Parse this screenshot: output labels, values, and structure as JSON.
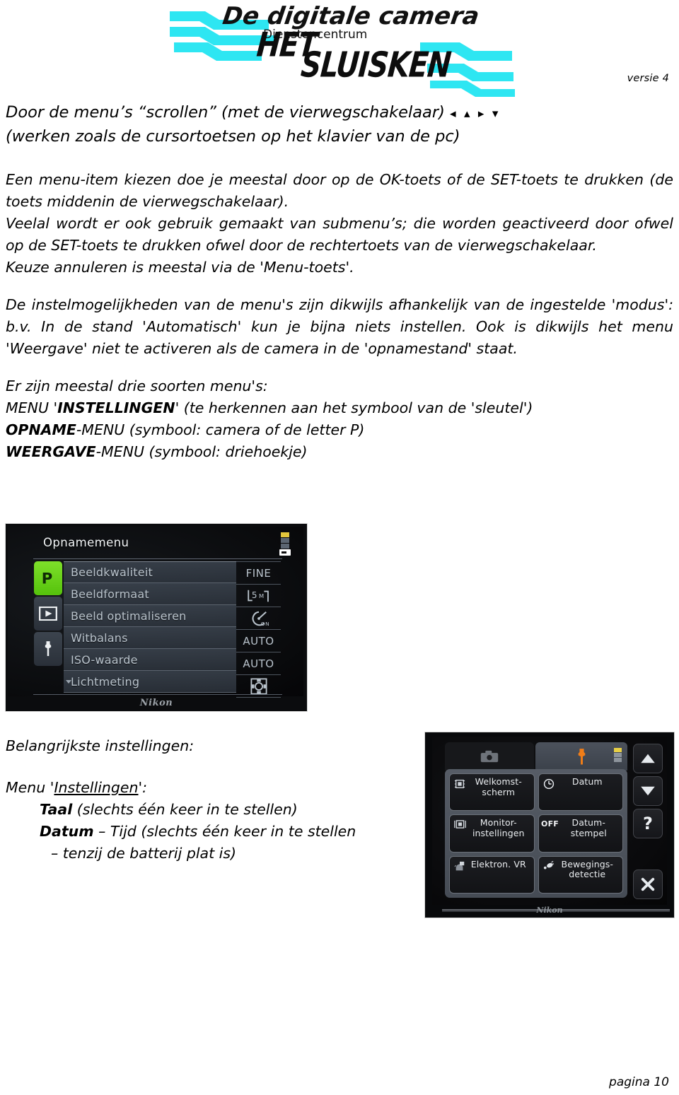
{
  "header": {
    "logo_title": "De digitale camera",
    "logo_sub": "Dienstencentrum",
    "logo_word1": "HET",
    "logo_word2": "SLUISKEN",
    "version_label": "versie 4",
    "logo_stripe_color": "#2ee6f2"
  },
  "body": {
    "line1": "Door de menu’s “scrollen” (met de vierwegschakelaar)",
    "arrows": "◂ ▴ ▸ ▾",
    "line2": "(werken zoals de cursortoetsen op het klavier van de pc)",
    "para1": "Een menu-item kiezen doe je meestal door op de OK-toets of de SET-toets te drukken (de toets middenin de vierwegschakelaar).",
    "para2": "Veelal wordt er ook gebruik gemaakt van submenu’s; die worden geactiveerd door ofwel op de SET-toets te drukken ofwel door de rechtertoets van de vierwegschakelaar.",
    "para3": "Keuze annuleren is meestal via de 'Menu-toets'.",
    "para4": "De instelmogelijkheden van de menu's zijn dikwijls afhankelijk van de ingestelde 'modus': b.v. In de stand 'Automatisch' kun je bijna niets instellen. Ook is dikwijls het menu 'Weergave' niet te activeren als de camera in de 'opnamestand' staat.",
    "para5": "Er zijn meestal drie soorten menu's:",
    "menu_kinds": [
      {
        "prefix": "MENU '",
        "bold": "INSTELLINGEN",
        "suffix": "' (te herkennen aan het symbool van de 'sleutel')"
      },
      {
        "prefix": "",
        "bold": "OPNAME",
        "suffix": "-MENU (symbool: camera of de letter P)"
      },
      {
        "prefix": "",
        "bold": "WEERGAVE",
        "suffix": "-MENU (symbool: driehoekje)"
      }
    ]
  },
  "shot1": {
    "title": "Opnamemenu",
    "brand": "Nikon",
    "tabs": [
      {
        "name": "opname-tab",
        "glyph": "P",
        "active": true
      },
      {
        "name": "weergave-tab",
        "glyph": "play",
        "active": false
      },
      {
        "name": "instellingen-tab",
        "glyph": "wrench",
        "active": false
      }
    ],
    "rows": [
      {
        "label": "Beeldkwaliteit",
        "value": "FINE",
        "value_type": "text"
      },
      {
        "label": "Beeldformaat",
        "value": "5M",
        "value_type": "size-icon"
      },
      {
        "label": "Beeld optimaliseren",
        "value": "ON",
        "value_type": "optimise-icon"
      },
      {
        "label": "Witbalans",
        "value": "AUTO",
        "value_type": "text"
      },
      {
        "label": "ISO-waarde",
        "value": "AUTO",
        "value_type": "text"
      },
      {
        "label": "Lichtmeting",
        "value": "matrix",
        "value_type": "meter-icon"
      }
    ],
    "active_tab_color": "#6fd820"
  },
  "lower": {
    "heading": "Belangrijkste instellingen:",
    "menu_label_prefix": "Menu '",
    "menu_label_underlined": "Instellingen",
    "menu_label_suffix": "':",
    "items": [
      {
        "bold": "Taal",
        "rest": " (slechts één keer in te stellen)"
      },
      {
        "bold": "Datum",
        "rest": " – Tijd (slechts één keer in te stellen"
      }
    ],
    "item2_cont": "– tenzij de batterij plat is)"
  },
  "shot2": {
    "brand": "Nikon",
    "tabs": [
      {
        "name": "camera-tab",
        "icon": "camera-icon",
        "active": false
      },
      {
        "name": "wrench-tab",
        "icon": "wrench-icon",
        "active": true,
        "color": "#f07d18"
      }
    ],
    "cells": [
      {
        "icon": "welcome-screen-icon",
        "label": "Welkomst-\nscherm"
      },
      {
        "icon": "clock-icon",
        "label": "Datum"
      },
      {
        "icon": "monitor-icon",
        "label": "Monitor-\ninstellingen"
      },
      {
        "icon": "off-label",
        "label": "Datum-\nstempel",
        "icon_text": "OFF"
      },
      {
        "icon": "vr-hand-icon",
        "label": "Elektron. VR"
      },
      {
        "icon": "motion-detect-icon",
        "label": "Bewegings-\ndetectie"
      }
    ],
    "side_buttons": [
      {
        "name": "scroll-up-button",
        "icon": "triangle-up-icon"
      },
      {
        "name": "scroll-down-button",
        "icon": "triangle-down-icon"
      },
      {
        "name": "help-button",
        "icon": "question-mark-icon",
        "label": "?"
      },
      {
        "name": "close-button",
        "icon": "x-close-icon"
      }
    ]
  },
  "footer": {
    "page_label": "pagina 10"
  }
}
